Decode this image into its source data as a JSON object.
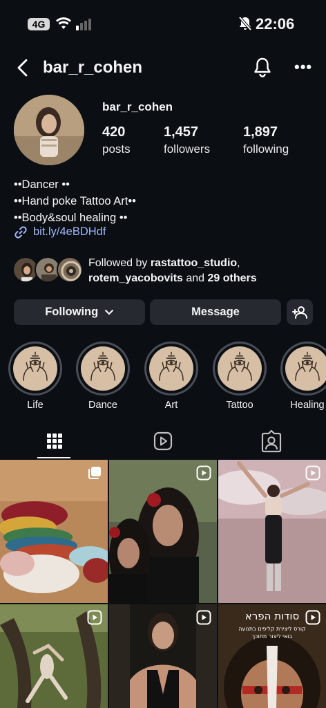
{
  "status_bar": {
    "network": "4G",
    "time": "22:06"
  },
  "header": {
    "title": "bar_r_cohen"
  },
  "profile": {
    "name": "bar_r_cohen",
    "stats": [
      {
        "num": "420",
        "label": "posts"
      },
      {
        "num": "1,457",
        "label": "followers"
      },
      {
        "num": "1,897",
        "label": "following"
      }
    ],
    "bio": [
      "••Dancer ••",
      "••Hand poke Tattoo Art••",
      "••Body&soul healing ••"
    ],
    "link": "bit.ly/4eBDHdf"
  },
  "followed_by": {
    "prefix": "Followed by ",
    "user1": "rastattoo_studio",
    "sep": ",",
    "user2": "rotem_yacobovits",
    "mid": " and ",
    "others": "29 others"
  },
  "buttons": {
    "following": "Following",
    "message": "Message"
  },
  "highlights": [
    "Life",
    "Dance",
    "Art",
    "Tattoo",
    "Healing"
  ],
  "grid": {
    "tiles": [
      {
        "type": "carousel"
      },
      {
        "type": "reel"
      },
      {
        "type": "reel"
      },
      {
        "type": "reel"
      },
      {
        "type": "reel"
      },
      {
        "type": "reel",
        "title": "סודות הפרא",
        "subtitle": "קורס ליצירת קליפים בתנועה",
        "subtitle2": "בואי ליצור מתוכך"
      }
    ]
  },
  "colors": {
    "background": "#0b0f14",
    "button": "#262a30",
    "link": "#a2b4f7",
    "highlight_bg": "#d7bfa6"
  }
}
